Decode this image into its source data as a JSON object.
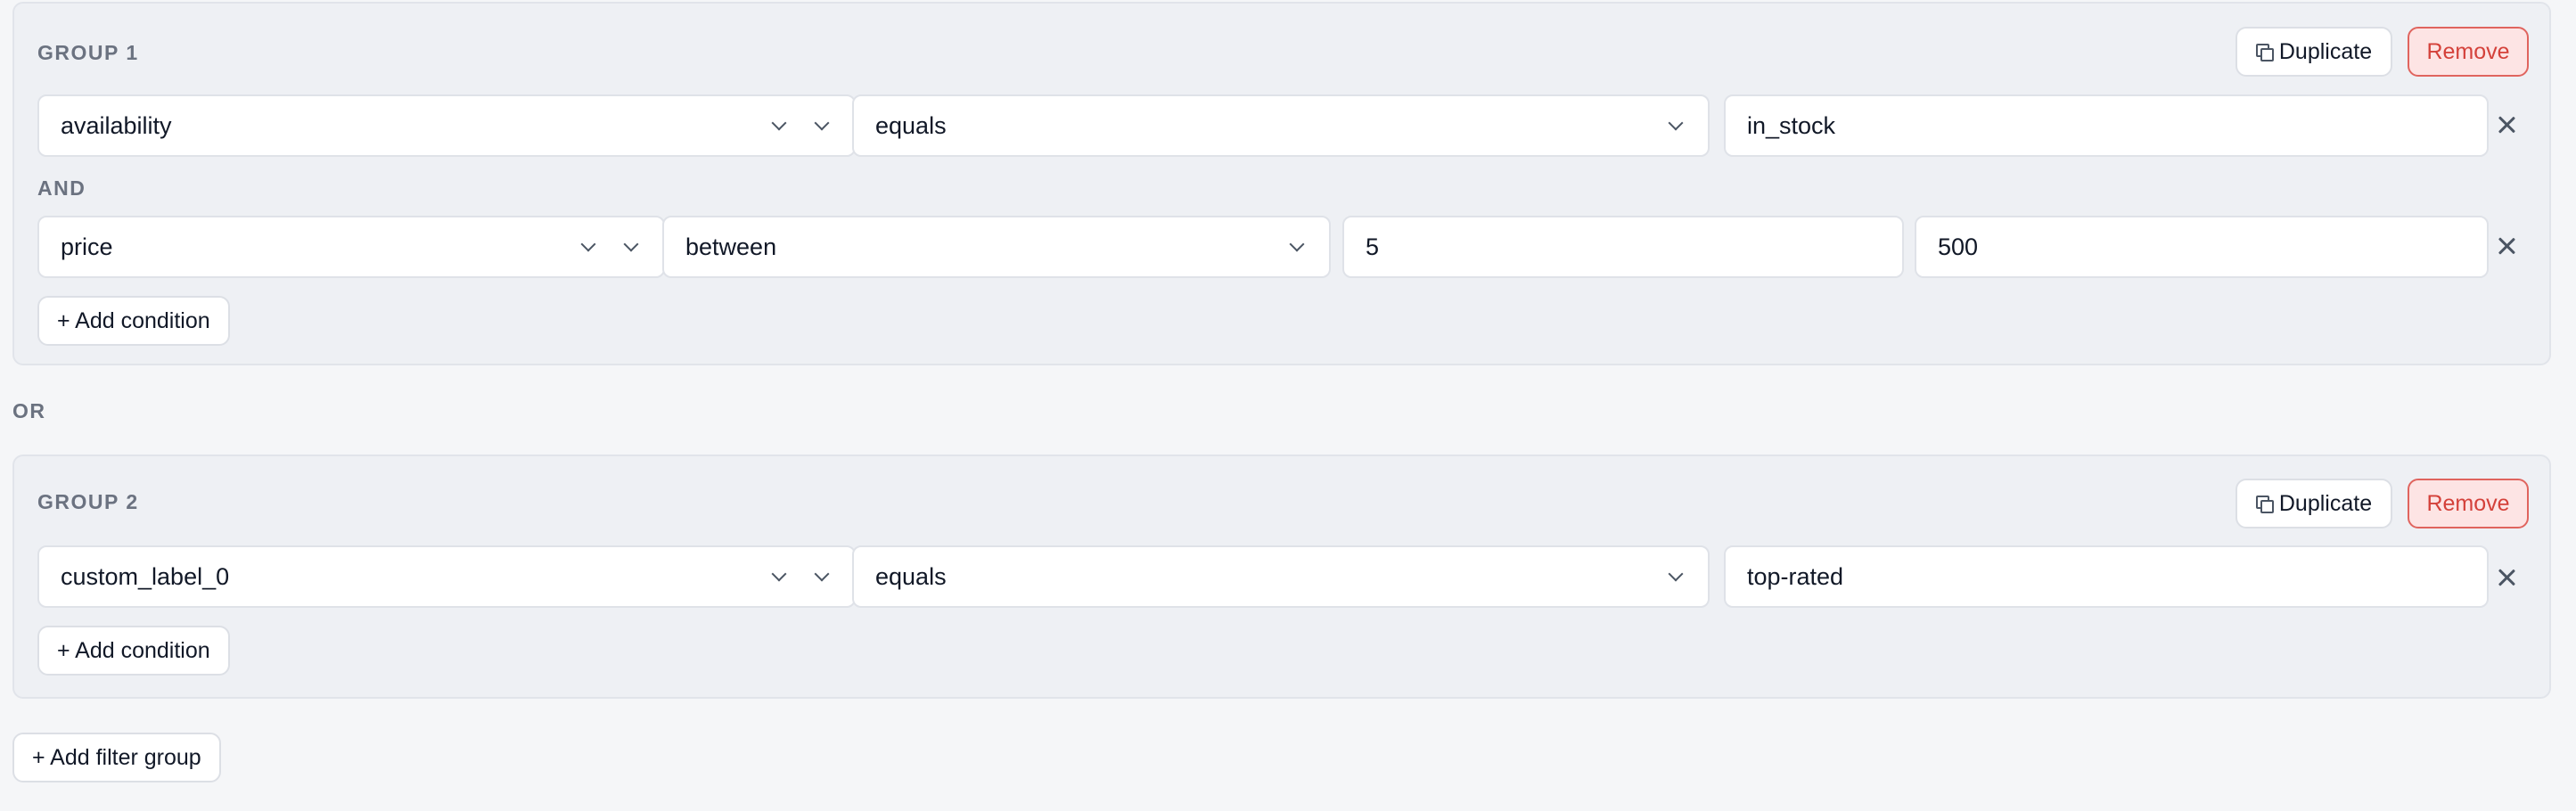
{
  "groups": [
    {
      "title": "GROUP 1",
      "duplicate_label": "Duplicate",
      "remove_label": "Remove",
      "conditions": [
        {
          "field": "availability",
          "operator": "equals",
          "values": [
            "in_stock"
          ]
        },
        {
          "field": "price",
          "operator": "between",
          "values": [
            "5",
            "500"
          ]
        }
      ],
      "joiner": "AND",
      "add_condition_label": "+ Add condition"
    },
    {
      "title": "GROUP 2",
      "duplicate_label": "Duplicate",
      "remove_label": "Remove",
      "conditions": [
        {
          "field": "custom_label_0",
          "operator": "equals",
          "values": [
            "top-rated"
          ]
        }
      ],
      "add_condition_label": "+ Add condition"
    }
  ],
  "group_joiner": "OR",
  "add_filter_group_label": "+ Add filter group",
  "icons": {
    "duplicate": "duplicate-icon",
    "dropdown": "chevron-down-icon",
    "remove_condition": "close-icon"
  },
  "colors": {
    "remove_bg": "#fde4e4",
    "remove_border": "#e0645e",
    "remove_text": "#d4413a"
  }
}
